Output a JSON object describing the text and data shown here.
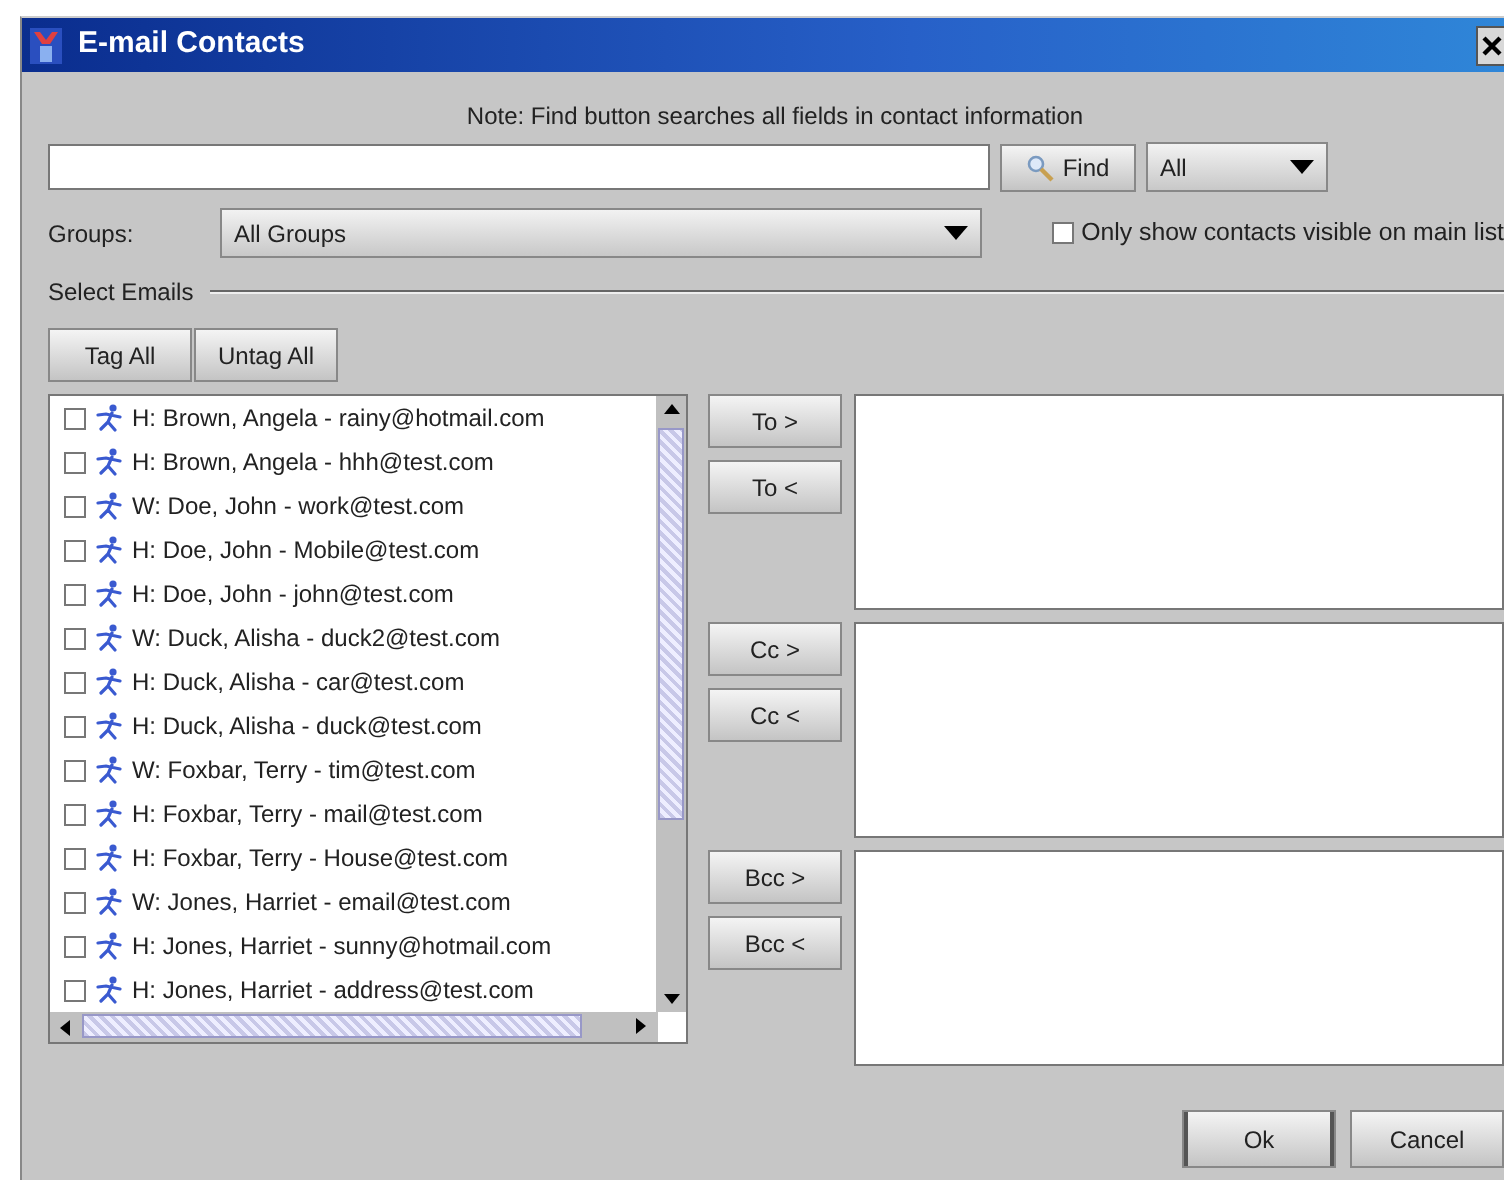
{
  "window": {
    "title": "E-mail Contacts"
  },
  "note": "Note: Find  button searches all fields in contact information",
  "search": {
    "find_button": "Find",
    "scope": "All"
  },
  "groups": {
    "label": "Groups:",
    "value": "All Groups"
  },
  "visible_only": {
    "label": "Only show contacts visible on main list",
    "checked": false
  },
  "section_label": "Select Emails",
  "tag_buttons": [
    "Tag All",
    "Untag All"
  ],
  "contacts": [
    {
      "label": "H: Brown, Angela - rainy@hotmail.com",
      "checked": false
    },
    {
      "label": "H: Brown, Angela - hhh@test.com",
      "checked": false
    },
    {
      "label": "W: Doe, John - work@test.com",
      "checked": false
    },
    {
      "label": "H: Doe, John - Mobile@test.com",
      "checked": false
    },
    {
      "label": "H: Doe, John - john@test.com",
      "checked": false
    },
    {
      "label": "W: Duck, Alisha - duck2@test.com",
      "checked": false
    },
    {
      "label": "H: Duck, Alisha - car@test.com",
      "checked": false
    },
    {
      "label": "H: Duck, Alisha - duck@test.com",
      "checked": false
    },
    {
      "label": "W: Foxbar, Terry - tim@test.com",
      "checked": false
    },
    {
      "label": "H: Foxbar, Terry - mail@test.com",
      "checked": false
    },
    {
      "label": "H: Foxbar, Terry - House@test.com",
      "checked": false
    },
    {
      "label": "W: Jones, Harriet - email@test.com",
      "checked": false
    },
    {
      "label": "H: Jones, Harriet - sunny@hotmail.com",
      "checked": false
    },
    {
      "label": "H: Jones, Harriet - address@test.com",
      "checked": false
    }
  ],
  "recipients": [
    {
      "add_button": "To >",
      "remove_button": "To <"
    },
    {
      "add_button": "Cc >",
      "remove_button": "Cc <"
    },
    {
      "add_button": "Bcc >",
      "remove_button": "Bcc <"
    }
  ],
  "footer_buttons": [
    "Ok",
    "Cancel"
  ]
}
